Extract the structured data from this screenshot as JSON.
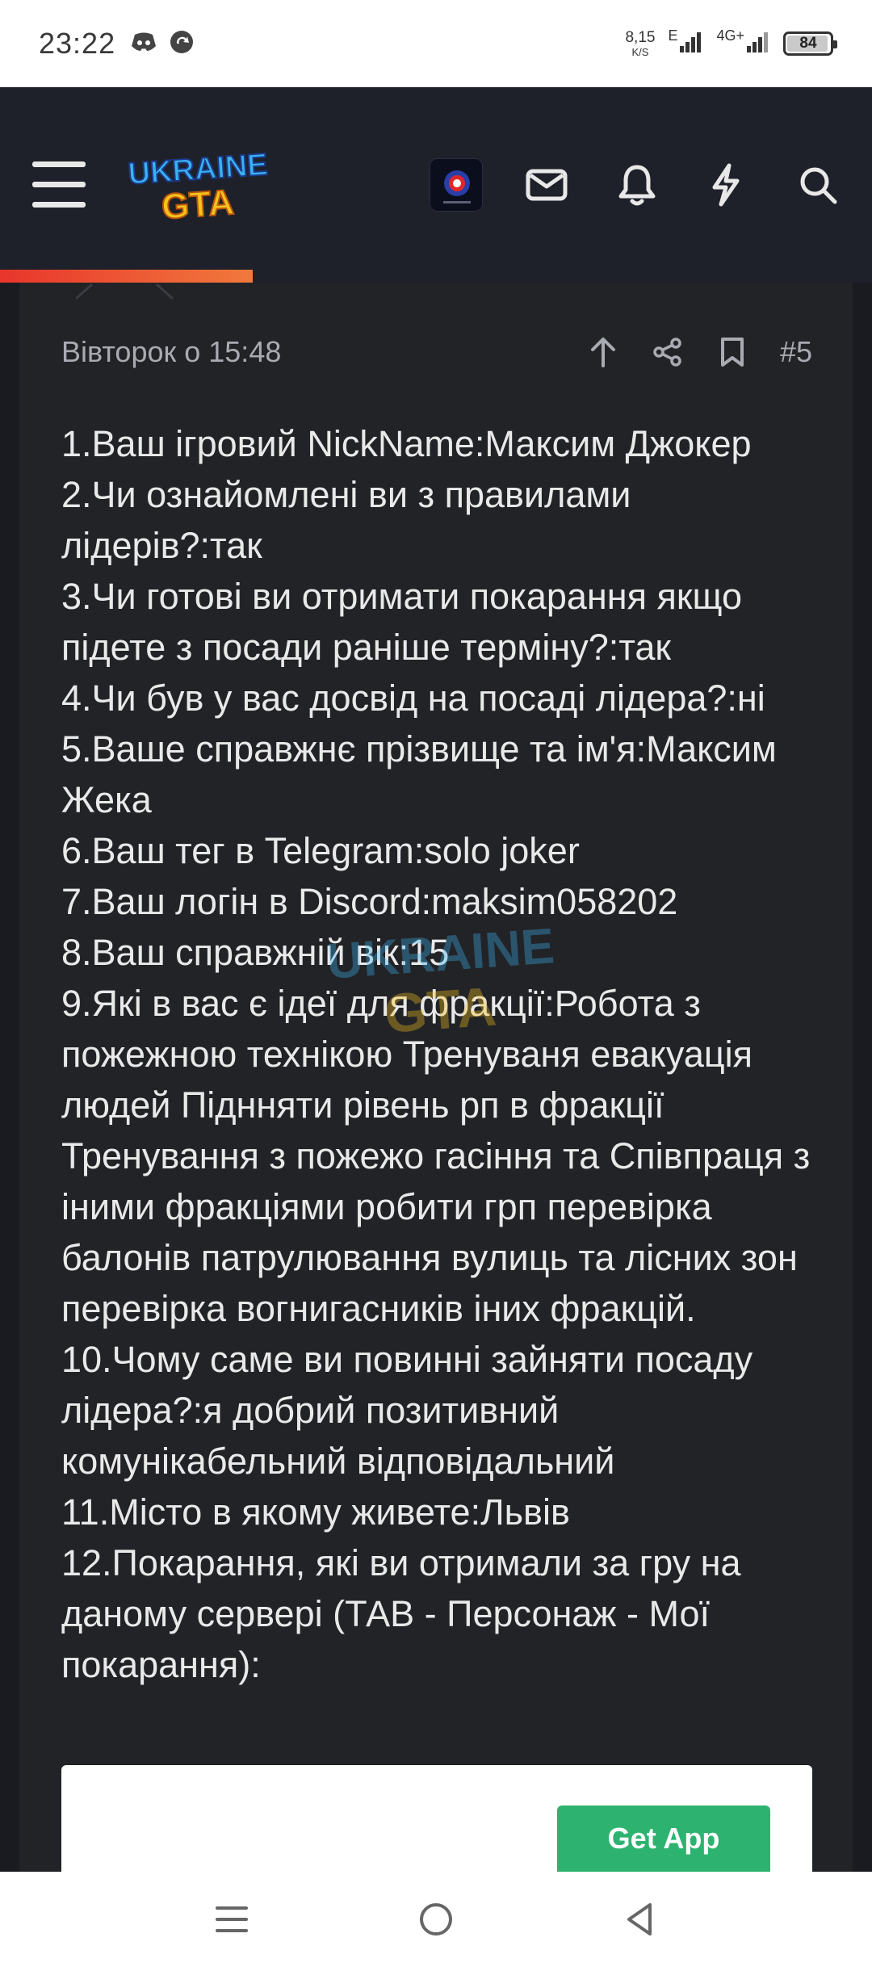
{
  "status_bar": {
    "time": "23:22",
    "net_speed_value": "8,15",
    "net_speed_unit": "K/S",
    "network_label_1": "E",
    "network_label_2": "4G+",
    "battery_level": "84",
    "icons": [
      "discord-icon",
      "sync-icon",
      "signal-icon",
      "signal-icon-2",
      "battery-icon"
    ]
  },
  "header": {
    "logo_text_line1": "UKRAINE",
    "logo_text_line2": "GTA",
    "icons": [
      "menu-icon",
      "user-avatar",
      "mail-icon",
      "bell-icon",
      "bolt-icon",
      "search-icon"
    ],
    "progress_fraction": 0.29,
    "colors": {
      "accent_start": "#e8352c",
      "accent_end": "#f1793c",
      "background": "#1e2129"
    }
  },
  "post": {
    "date": "Вівторок о 15:48",
    "number": "#5",
    "actions": [
      "arrow-up-icon",
      "share-icon",
      "bookmark-icon"
    ],
    "lines": [
      "1.Ваш ігровий NickName:Максим Джокер",
      "2.Чи ознайомлені ви з правилами лідерів?:так",
      "3.Чи готові ви отримати покарання якщо підете з посади раніше терміну?:так",
      "4.Чи був у вас досвід на посаді лідера?:ні",
      "5.Ваше справжнє прізвище та ім'я:Максим Жека",
      "6.Ваш тег в Telegram:solo joker",
      "7.Ваш логін в Discord:maksim058202",
      "8.Ваш справжній вік:15",
      "9.Які в вас є ідеї для фракції:Робота з пожежною технікою Тренуваня евакуація людей Піднняти рівень рп в фракції Тренування з пожежо гасіння та Співпраця з іними фракціями робити грп перевірка балонів патрулювання вулиць та лісних зон перевірка вогнигасників іних фракцій.",
      "10.Чому саме ви повинні зайняти посаду лідера?:я добрий позитивний комунікабельний відповідальний",
      "11.Місто в якому живете:Львів",
      "12.Покарання, які ви отримали за гру на даному сервері (ТАВ - Персонаж - Мої покарання):"
    ]
  },
  "ad": {
    "button_label": "Get App",
    "button_color": "#2db36f"
  },
  "nav_bar": {
    "icons": [
      "recent-apps-icon",
      "home-icon",
      "back-icon"
    ]
  }
}
